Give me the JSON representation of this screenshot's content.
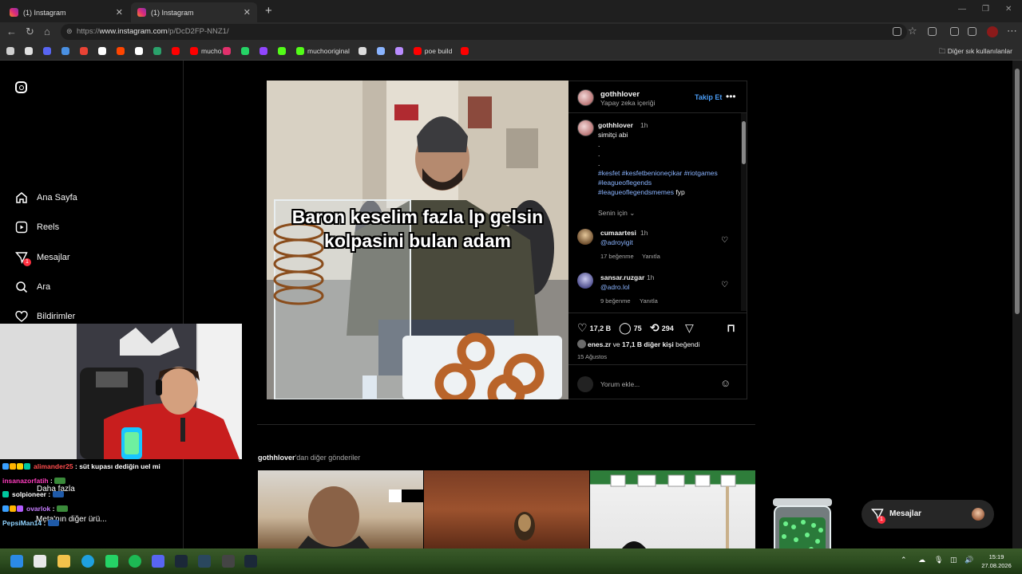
{
  "browser": {
    "tabs": [
      {
        "title": "(1) Instagram",
        "active": false
      },
      {
        "title": "(1) Instagram",
        "active": true
      }
    ],
    "url_prefix": "https://",
    "url_host": "www.instagram.com",
    "url_path": "/p/DcD2FP-NNZ1/",
    "bookmarks": [
      {
        "label": "",
        "color": "#cfcfcf"
      },
      {
        "label": "",
        "color": "#e0e0e0"
      },
      {
        "label": "",
        "color": "#5865f2"
      },
      {
        "label": "",
        "color": "#4a90e2"
      },
      {
        "label": "",
        "color": "#ea4335"
      },
      {
        "label": "",
        "color": "#ffffff"
      },
      {
        "label": "",
        "color": "#ff4500"
      },
      {
        "label": "",
        "color": "#ffffff"
      },
      {
        "label": "",
        "color": "#2aa16b"
      },
      {
        "label": "",
        "color": "#ff0000"
      },
      {
        "label": "mucho",
        "color": "#ff0000"
      },
      {
        "label": "",
        "color": "#e1306c"
      },
      {
        "label": "",
        "color": "#25d366"
      },
      {
        "label": "",
        "color": "#9146ff"
      },
      {
        "label": "",
        "color": "#53fc18"
      },
      {
        "label": "muchooriginal",
        "color": "#53fc18"
      },
      {
        "label": "",
        "color": "#dddddd"
      },
      {
        "label": "",
        "color": "#8ab4ff"
      },
      {
        "label": "",
        "color": "#b98cff"
      },
      {
        "label": "poe build",
        "color": "#ff0000"
      },
      {
        "label": "",
        "color": "#ff0000"
      }
    ],
    "other_bookmarks": "Diğer sık kullanılanlar"
  },
  "sidebar": {
    "items": [
      {
        "label": "Ana Sayfa",
        "icon": "home-icon"
      },
      {
        "label": "Reels",
        "icon": "reels-icon"
      },
      {
        "label": "Mesajlar",
        "icon": "messages-icon",
        "badge": "1"
      },
      {
        "label": "Ara",
        "icon": "search-icon"
      },
      {
        "label": "Bildirimler",
        "icon": "heart-icon"
      }
    ],
    "more_label": "Daha fazla",
    "meta_label": "Meta'nın diğer ürü..."
  },
  "post": {
    "overlay_text": "Baron keselim fazla lp gelsin kolpasini bulan adam",
    "author": "gothhlover",
    "author_sub": "Yapay zeka içeriği",
    "follow_label": "Takip Et",
    "caption_user": "gothhlover",
    "caption_time": "1h",
    "caption_text": "simitçi abi",
    "caption_dots": [
      ".",
      ".",
      "."
    ],
    "hashtags_line1": "#kesfet #kesfetbenioneçikar #riotgames",
    "hashtags_line2": "#leagueoflegends",
    "hashtags_line3": "#leagueoflegendsmemes",
    "hashtags_tail": "fyp",
    "for_you": "Senin için",
    "comments": [
      {
        "user": "cumaartesi",
        "time": "1h",
        "text": "@adroyigit",
        "likes": "17 beğenme",
        "reply": "Yanıtla"
      },
      {
        "user": "sansar.ruzgar",
        "time": "1h",
        "text": "@adro.lol",
        "likes": "9 beğenme",
        "reply": "Yanıtla"
      }
    ],
    "like_count": "17,2 B",
    "comment_count": "75",
    "repost_count": "294",
    "liked_by_user": "enes.zr",
    "liked_by_mid": "ve",
    "liked_by_count": "17,1 B diğer kişi",
    "liked_by_tail": "beğendi",
    "date": "15 Ağustos",
    "comment_placeholder": "Yorum ekle..."
  },
  "more_posts": {
    "user": "gothhlover",
    "suffix": "'dan diğer gönderiler"
  },
  "dm_pill": {
    "label": "Mesajlar",
    "badge": "1"
  },
  "chat": [
    {
      "user": "alimander25",
      "text": ": süt kupası dediğin uel mi",
      "color": "#ff4d4d"
    },
    {
      "user": "insanazorfatih",
      "text": ":",
      "color": "#ff3cbe"
    },
    {
      "user": "solpioneer",
      "text": ":",
      "color": "#ffffff"
    },
    {
      "user": "ovarlok",
      "text": ":",
      "color": "#c77dff"
    },
    {
      "user": "PepsiMan14",
      "text": ":",
      "color": "#8fd3ff"
    }
  ],
  "clock": {
    "time": "15:19",
    "date": "27.08.2026"
  }
}
